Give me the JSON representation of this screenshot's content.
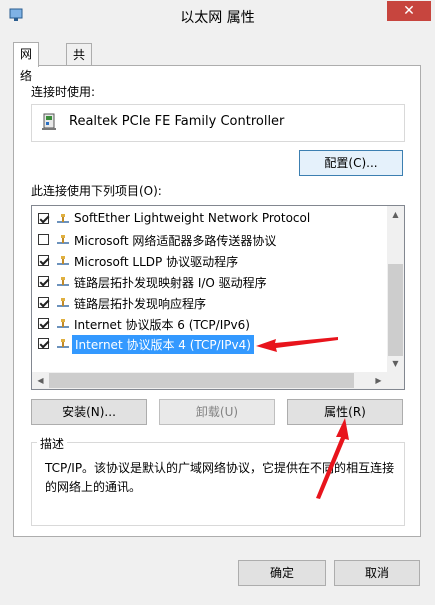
{
  "window": {
    "title": "以太网 属性",
    "close_label": "✕"
  },
  "tabs": [
    {
      "label": "网络"
    },
    {
      "label": "共享"
    }
  ],
  "network": {
    "connect_using_label": "连接时使用:",
    "adapter_name": "Realtek PCIe FE Family Controller",
    "configure_button": "配置(C)...",
    "items_label": "此连接使用下列项目(O):",
    "items": [
      {
        "label": "SoftEther Lightweight Network Protocol",
        "checked": true
      },
      {
        "label": "Microsoft 网络适配器多路传送器协议",
        "checked": false
      },
      {
        "label": "Microsoft LLDP 协议驱动程序",
        "checked": true
      },
      {
        "label": "链路层拓扑发现映射器 I/O 驱动程序",
        "checked": true
      },
      {
        "label": "链路层拓扑发现响应程序",
        "checked": true
      },
      {
        "label": "Internet 协议版本 6 (TCP/IPv6)",
        "checked": true
      },
      {
        "label": "Internet 协议版本 4 (TCP/IPv4)",
        "checked": true,
        "selected": true
      }
    ],
    "install_button": "安装(N)...",
    "uninstall_button": "卸载(U)",
    "properties_button": "属性(R)",
    "description_label": "描述",
    "description_text": "TCP/IP。该协议是默认的广域网络协议，它提供在不同的相互连接的网络上的通讯。"
  },
  "footer": {
    "ok_button": "确定",
    "cancel_button": "取消"
  },
  "colors": {
    "selection": "#3399ff",
    "annotation_arrow": "#e8141c",
    "close_button": "#c7453e"
  }
}
